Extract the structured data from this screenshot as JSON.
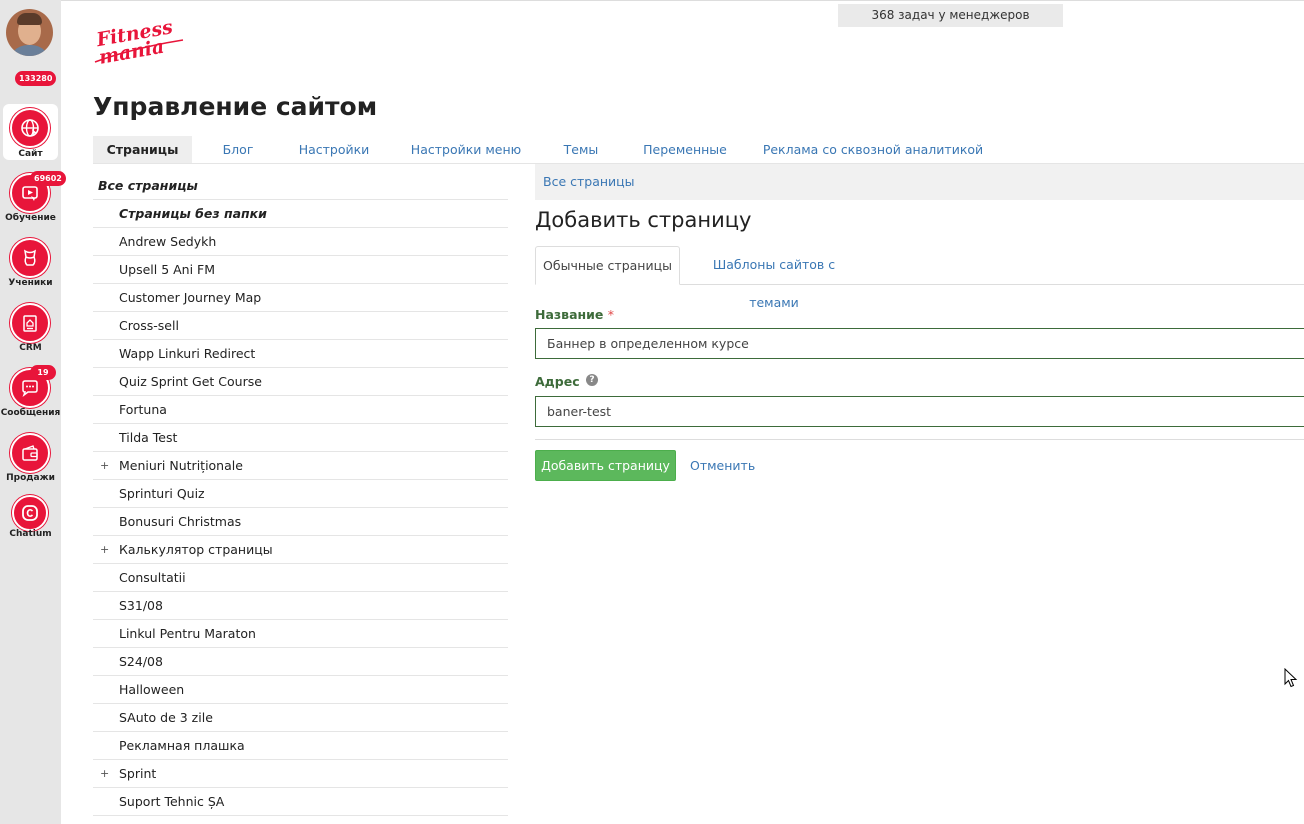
{
  "user": {
    "badge": "133280"
  },
  "sidebar": {
    "items": [
      {
        "label": "Сайт",
        "icon": "globe-icon",
        "badge": ""
      },
      {
        "label": "Обучение",
        "icon": "training-icon",
        "badge": "69602"
      },
      {
        "label": "Ученики",
        "icon": "students-icon",
        "badge": ""
      },
      {
        "label": "CRM",
        "icon": "crm-icon",
        "badge": ""
      },
      {
        "label": "Сообщения",
        "icon": "messages-icon",
        "badge": "19"
      },
      {
        "label": "Продажи",
        "icon": "wallet-icon",
        "badge": ""
      },
      {
        "label": "Chatium",
        "icon": "chatium-icon",
        "badge": ""
      }
    ]
  },
  "header": {
    "logo_text": "Fitness mania",
    "tasks": "368 задач у менеджеров",
    "title": "Управление сайтом"
  },
  "tabs": [
    {
      "label": "Страницы",
      "active": true
    },
    {
      "label": "Блог",
      "active": false
    },
    {
      "label": "Настройки",
      "active": false
    },
    {
      "label": "Настройки меню",
      "active": false
    },
    {
      "label": "Темы",
      "active": false
    },
    {
      "label": "Переменные",
      "active": false
    },
    {
      "label": "Реклама со сквозной аналитикой",
      "active": false
    }
  ],
  "tree": {
    "root": "Все страницы",
    "items": [
      {
        "label": "Страницы без папки",
        "folder": true,
        "expandable": false
      },
      {
        "label": "Andrew Sedykh",
        "folder": false,
        "expandable": false
      },
      {
        "label": "Upsell 5 Ani FM",
        "folder": false,
        "expandable": false
      },
      {
        "label": "Customer Journey Map",
        "folder": false,
        "expandable": false
      },
      {
        "label": "Cross-sell",
        "folder": false,
        "expandable": false
      },
      {
        "label": "Wapp Linkuri Redirect",
        "folder": false,
        "expandable": false
      },
      {
        "label": "Quiz Sprint Get Course",
        "folder": false,
        "expandable": false
      },
      {
        "label": "Fortuna",
        "folder": false,
        "expandable": false
      },
      {
        "label": "Tilda Test",
        "folder": false,
        "expandable": false
      },
      {
        "label": "Meniuri Nutriționale",
        "folder": false,
        "expandable": true
      },
      {
        "label": "Sprinturi Quiz",
        "folder": false,
        "expandable": false
      },
      {
        "label": "Bonusuri Christmas",
        "folder": false,
        "expandable": false
      },
      {
        "label": "Калькулятор страницы",
        "folder": false,
        "expandable": true
      },
      {
        "label": "Consultatii",
        "folder": false,
        "expandable": false
      },
      {
        "label": "S31/08",
        "folder": false,
        "expandable": false
      },
      {
        "label": "Linkul Pentru Maraton",
        "folder": false,
        "expandable": false
      },
      {
        "label": "S24/08",
        "folder": false,
        "expandable": false
      },
      {
        "label": "Halloween",
        "folder": false,
        "expandable": false
      },
      {
        "label": "SAuto de 3 zile",
        "folder": false,
        "expandable": false
      },
      {
        "label": "Рекламная плашка",
        "folder": false,
        "expandable": false
      },
      {
        "label": "Sprint",
        "folder": false,
        "expandable": true
      },
      {
        "label": "Suport Tehnic ȘA",
        "folder": false,
        "expandable": false
      }
    ],
    "plus_symbol": "+"
  },
  "form": {
    "breadcrumb": "Все страницы",
    "title": "Добавить страницу",
    "tabs": [
      {
        "label": "Обычные страницы",
        "active": true
      },
      {
        "label": "Шаблоны сайтов с темами",
        "active": false
      }
    ],
    "name_label": "Название",
    "required_mark": "*",
    "name_value": "Баннер в определенном курсе",
    "address_label": "Адрес",
    "help_symbol": "?",
    "address_value": "baner-test",
    "submit_label": "Добавить страницу",
    "cancel_label": "Отменить"
  },
  "colors": {
    "brand_red": "#e8153a",
    "link_blue": "#3a77b4",
    "success_green": "#5cb85c",
    "label_green": "#3d6b3a"
  }
}
